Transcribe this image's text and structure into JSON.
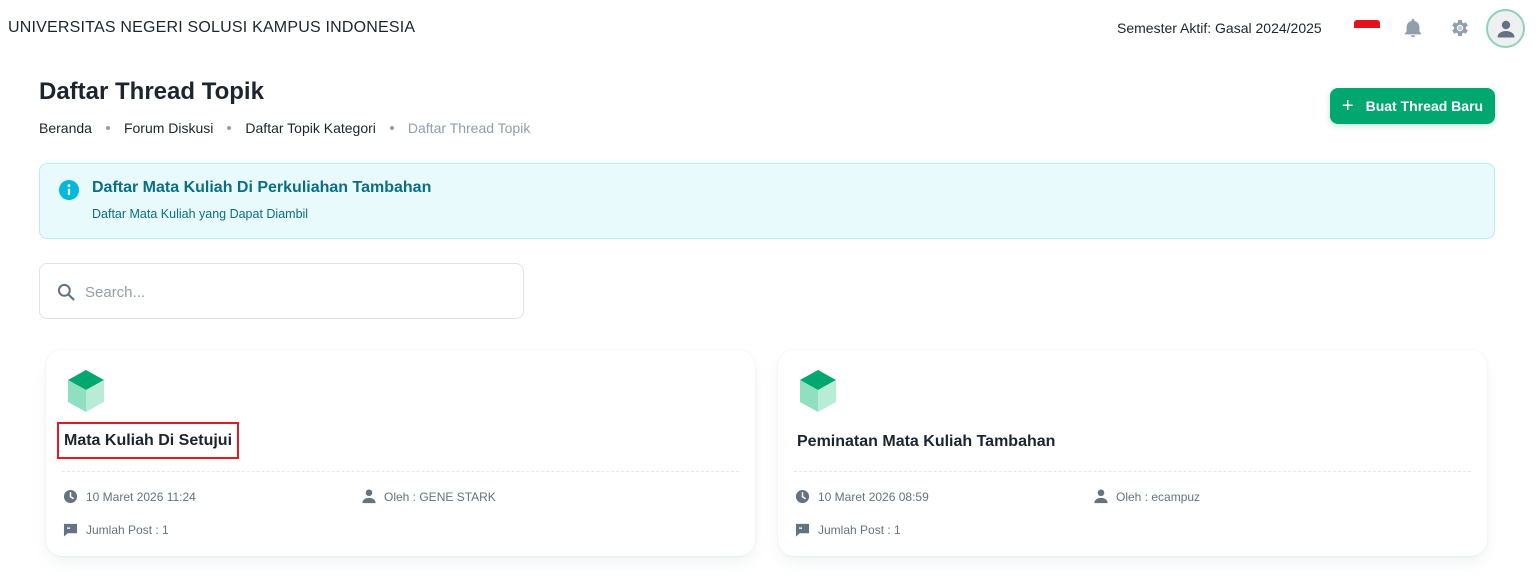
{
  "header": {
    "brand": "UNIVERSITAS NEGERI SOLUSI KAMPUS INDONESIA",
    "semester": "Semester Aktif: Gasal 2024/2025",
    "icons": [
      "flag-indonesia-icon",
      "bell-icon",
      "gear-icon",
      "user-avatar-icon"
    ]
  },
  "page": {
    "title": "Daftar Thread Topik",
    "breadcrumb": [
      "Beranda",
      "Forum Diskusi",
      "Daftar Topik Kategori",
      "Daftar Thread Topik"
    ],
    "new_thread_label": "Buat Thread Baru"
  },
  "alert": {
    "title": "Daftar Mata Kuliah Di Perkuliahan Tambahan",
    "description": "Daftar Mata Kuliah yang Dapat Diambil"
  },
  "search": {
    "placeholder": "Search..."
  },
  "threads": [
    {
      "title": "Mata Kuliah Di Setujui",
      "date": "10 Maret 2026 11:24",
      "author": "Oleh : GENE STARK",
      "posts": "Jumlah Post : 1",
      "highlighted": true
    },
    {
      "title": "Peminatan Mata Kuliah Tambahan",
      "date": "10 Maret 2026 08:59",
      "author": "Oleh : ecampuz",
      "posts": "Jumlah Post : 1",
      "highlighted": false
    }
  ],
  "colors": {
    "primary": "#00a76f",
    "info_bg": "#e9fafd",
    "info_text": "#0b6e87",
    "highlight_border": "#e01b24"
  }
}
